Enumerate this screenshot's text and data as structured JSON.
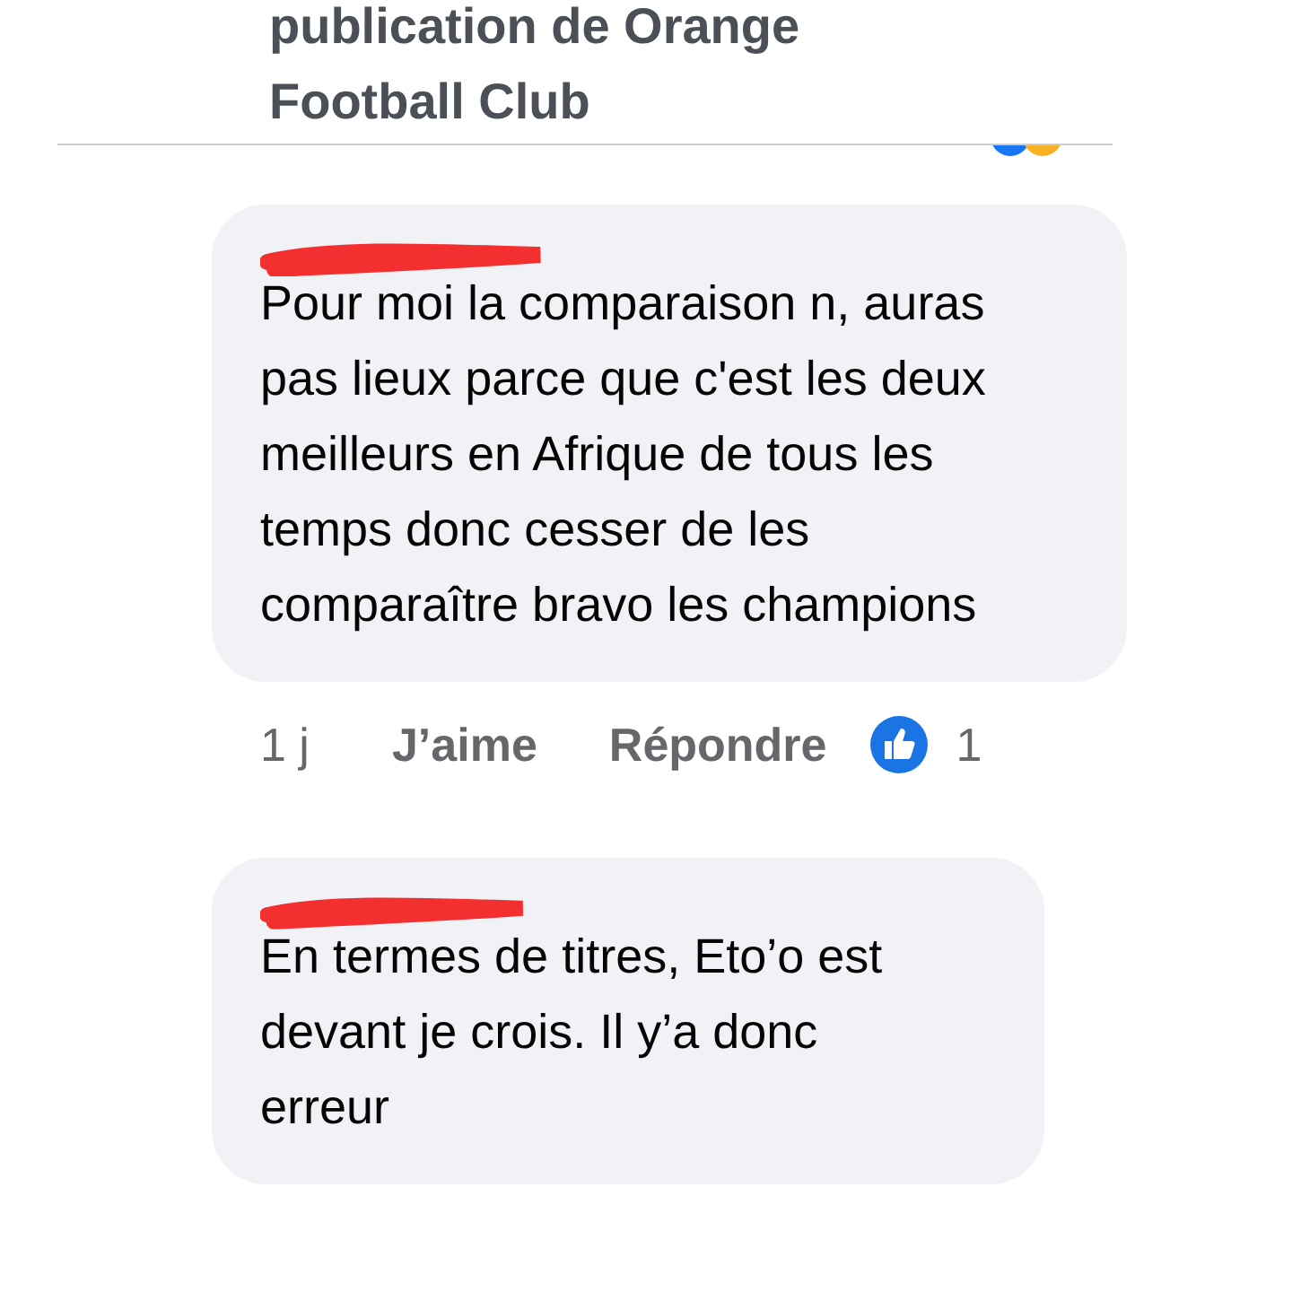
{
  "header": {
    "title": "publication de Orange Football Club"
  },
  "comments": [
    {
      "text": "Pour moi la comparaison n, auras pas lieux parce que c'est les deux meilleurs en Afrique de tous les temps donc cesser de les comparaître bravo les champions",
      "time": "1 j",
      "like": "J’aime",
      "reply": "Répondre",
      "reactions": "1"
    },
    {
      "text": "En termes de titres, Eto’o est devant je crois. Il y’a donc erreur"
    }
  ]
}
